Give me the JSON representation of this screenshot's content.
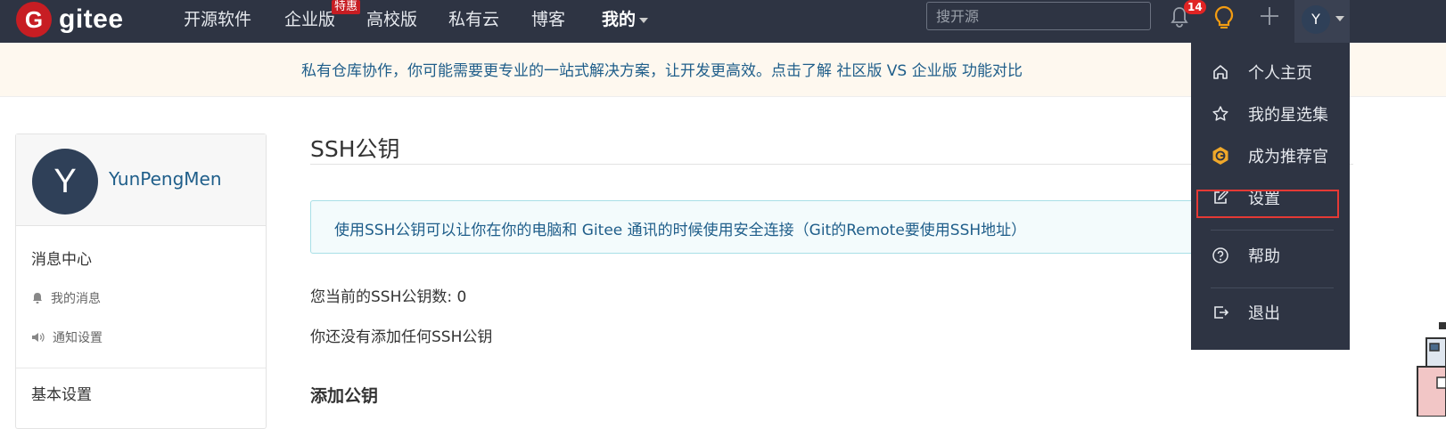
{
  "navbar": {
    "logo_letter": "G",
    "logo_text": "gitee",
    "items": [
      "开源软件",
      "企业版",
      "高校版",
      "私有云",
      "博客"
    ],
    "mine_label": "我的",
    "enterprise_badge": "特惠",
    "search_placeholder": "搜开源",
    "notification_count": "14",
    "avatar_letter": "Y",
    "icons": [
      "bell-icon",
      "bulb-icon",
      "plus-icon"
    ]
  },
  "banner": {
    "text": "私有仓库协作，你可能需要更专业的一站式解决方案，让开发更高效。点击了解 社区版 VS 企业版 功能对比"
  },
  "sidebar": {
    "avatar_letter": "Y",
    "username": "YunPengMen",
    "section_message": "消息中心",
    "item_my_messages": "我的消息",
    "item_notify_settings": "通知设置",
    "section_basic": "基本设置"
  },
  "main": {
    "title": "SSH公钥",
    "info": "使用SSH公钥可以让你在你的电脑和 Gitee 通讯的时候使用安全连接（Git的Remote要使用SSH地址）",
    "count": "您当前的SSH公钥数: 0",
    "empty": "你还没有添加任何SSH公钥",
    "add_title": "添加公钥"
  },
  "dropdown": {
    "items": [
      {
        "label": "个人主页",
        "icon": "home-icon"
      },
      {
        "label": "我的星选集",
        "icon": "star-icon"
      },
      {
        "label": "成为推荐官",
        "icon": "gitee-recommend-icon"
      },
      {
        "label": "设置",
        "icon": "edit-icon"
      },
      {
        "label": "帮助",
        "icon": "help-icon"
      },
      {
        "label": "退出",
        "icon": "logout-icon"
      }
    ]
  },
  "colors": {
    "navbar_bg": "#2e3443",
    "brand_red": "#c71d23",
    "link_blue": "#1f5e8a",
    "highlight_red": "#e53935",
    "bulb_orange": "#f39c12"
  }
}
